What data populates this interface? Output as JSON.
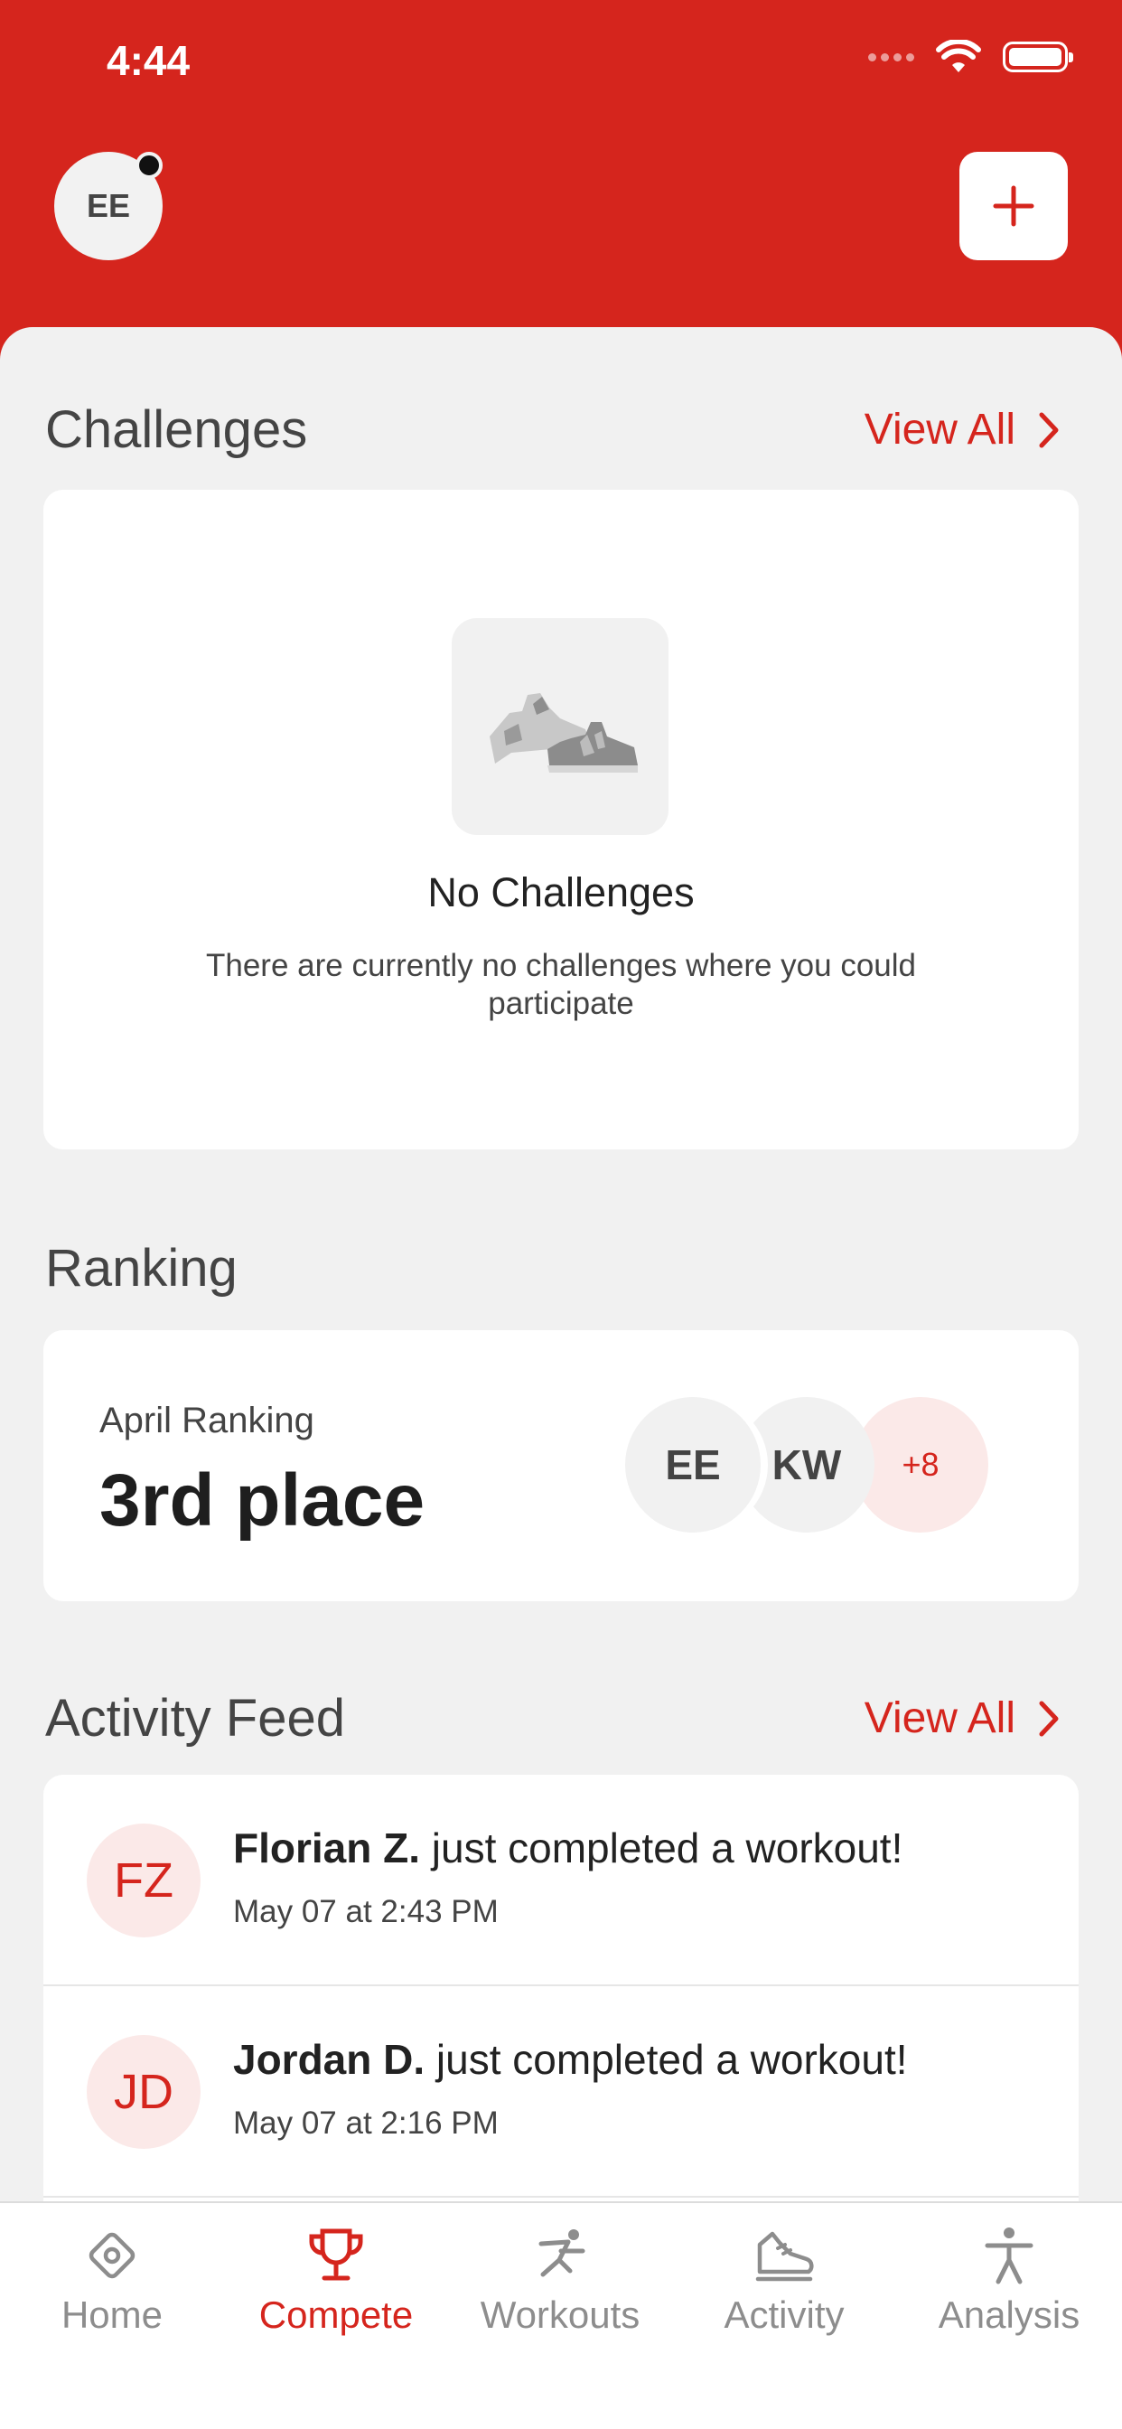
{
  "status_bar": {
    "time": "4:44"
  },
  "header": {
    "avatar_initials": "EE"
  },
  "challenges": {
    "title": "Challenges",
    "view_all": "View All",
    "empty_title": "No Challenges",
    "empty_text": "There are currently no challenges where you could participate"
  },
  "ranking": {
    "title": "Ranking",
    "label": "April Ranking",
    "place": "3rd place",
    "avatars": [
      "EE",
      "KW"
    ],
    "more": "+8"
  },
  "activity_feed": {
    "title": "Activity Feed",
    "view_all": "View All",
    "items": [
      {
        "initials": "FZ",
        "name": "Florian Z.",
        "action": " just completed a workout!",
        "time": "May 07 at 2:43 PM"
      },
      {
        "initials": "JD",
        "name": "Jordan D.",
        "action": " just completed a workout!",
        "time": "May 07 at 2:16 PM"
      }
    ]
  },
  "tabs": [
    {
      "label": "Home",
      "icon": "home-icon"
    },
    {
      "label": "Compete",
      "icon": "trophy-icon"
    },
    {
      "label": "Workouts",
      "icon": "running-icon"
    },
    {
      "label": "Activity",
      "icon": "shoe-icon"
    },
    {
      "label": "Analysis",
      "icon": "person-icon"
    }
  ],
  "active_tab": "Compete",
  "colors": {
    "accent": "#d5251d",
    "background": "#f1f1f1",
    "card": "#ffffff"
  }
}
